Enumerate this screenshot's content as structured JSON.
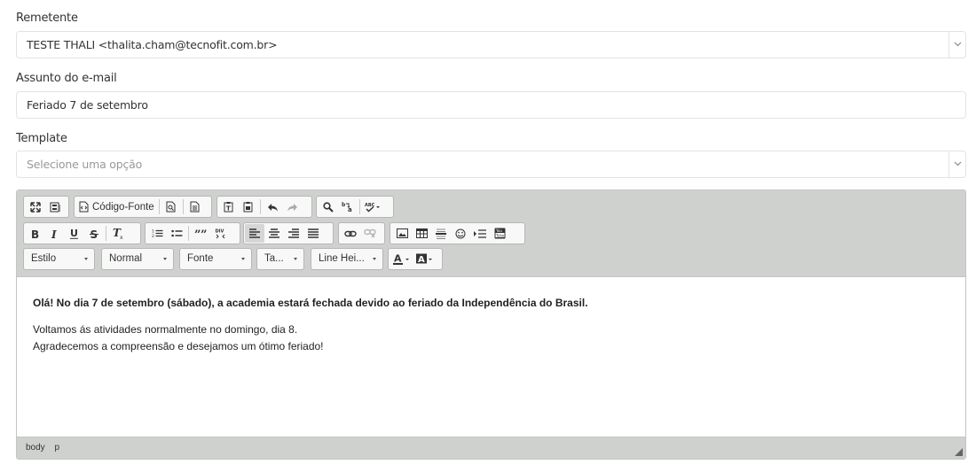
{
  "sender": {
    "label": "Remetente",
    "value": "TESTE THALI <thalita.cham@tecnofit.com.br>"
  },
  "subject": {
    "label": "Assunto do e-mail",
    "value": "Feriado 7 de setembro"
  },
  "template": {
    "label": "Template",
    "placeholder": "Selecione uma opção"
  },
  "editor": {
    "toolbar": {
      "source_label": "Código-Fonte",
      "styles_combo": "Estilo",
      "format_combo": "Normal",
      "font_combo": "Fonte",
      "size_combo": "Ta...",
      "lineheight_combo": "Line Hei..."
    },
    "content": {
      "line1": "Olá! No dia 7 de setembro (sábado), a academia estará fechada devido ao feriado da Independência do Brasil.",
      "line2": "Voltamos ás atividades normalmente no domingo, dia 8.",
      "line3": "Agradecemos a compreensão e desejamos um ótimo feriado!"
    },
    "path": [
      "body",
      "p"
    ]
  },
  "colors": {
    "toolbar_bg": "#cfd1cf",
    "border": "#e3e3e3",
    "text": "#333333"
  }
}
